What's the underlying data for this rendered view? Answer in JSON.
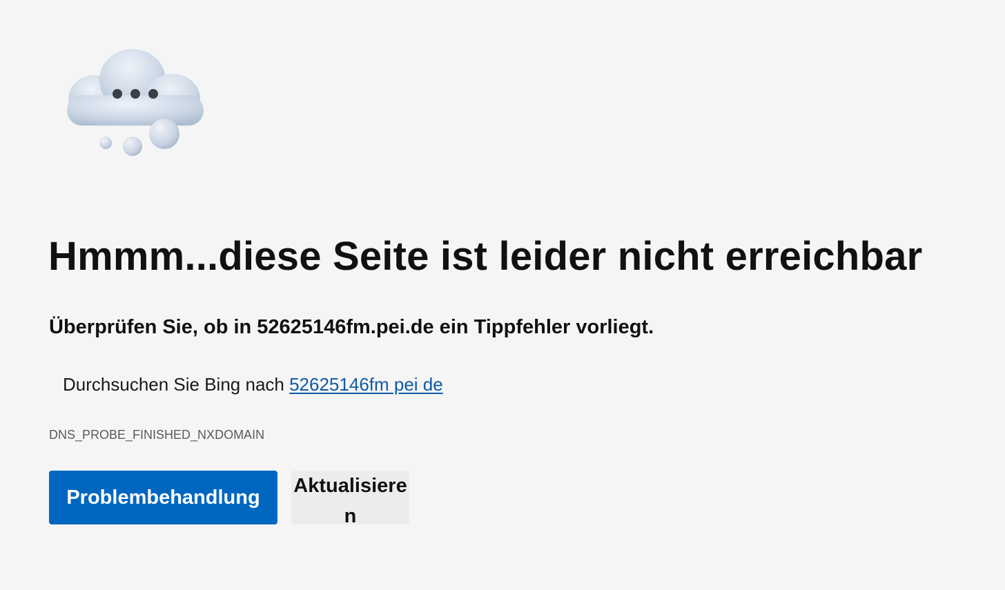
{
  "illustration": {
    "icon": "cloud-thinking-icon",
    "colors": {
      "cloud": "#cdd8e6",
      "cloud_shadow": "#aebdd0",
      "dots": "#3b3f47"
    }
  },
  "error": {
    "title": "Hmmm...diese Seite ist leider nicht erreichbar",
    "subtitle": "Überprüfen Sie, ob in 52625146fm.pei.de ein Tippfehler vorliegt.",
    "suggestion_prefix": "Durchsuchen Sie Bing nach ",
    "suggestion_link": "52625146fm pei de",
    "code": "DNS_PROBE_FINISHED_NXDOMAIN"
  },
  "buttons": {
    "troubleshoot_label": "Problembehandlung",
    "refresh_label": "Aktualisieren"
  },
  "colors": {
    "background": "#f5f5f5",
    "primary_button": "#0067c0",
    "secondary_button": "#ececec",
    "link": "#0e5aa7"
  }
}
